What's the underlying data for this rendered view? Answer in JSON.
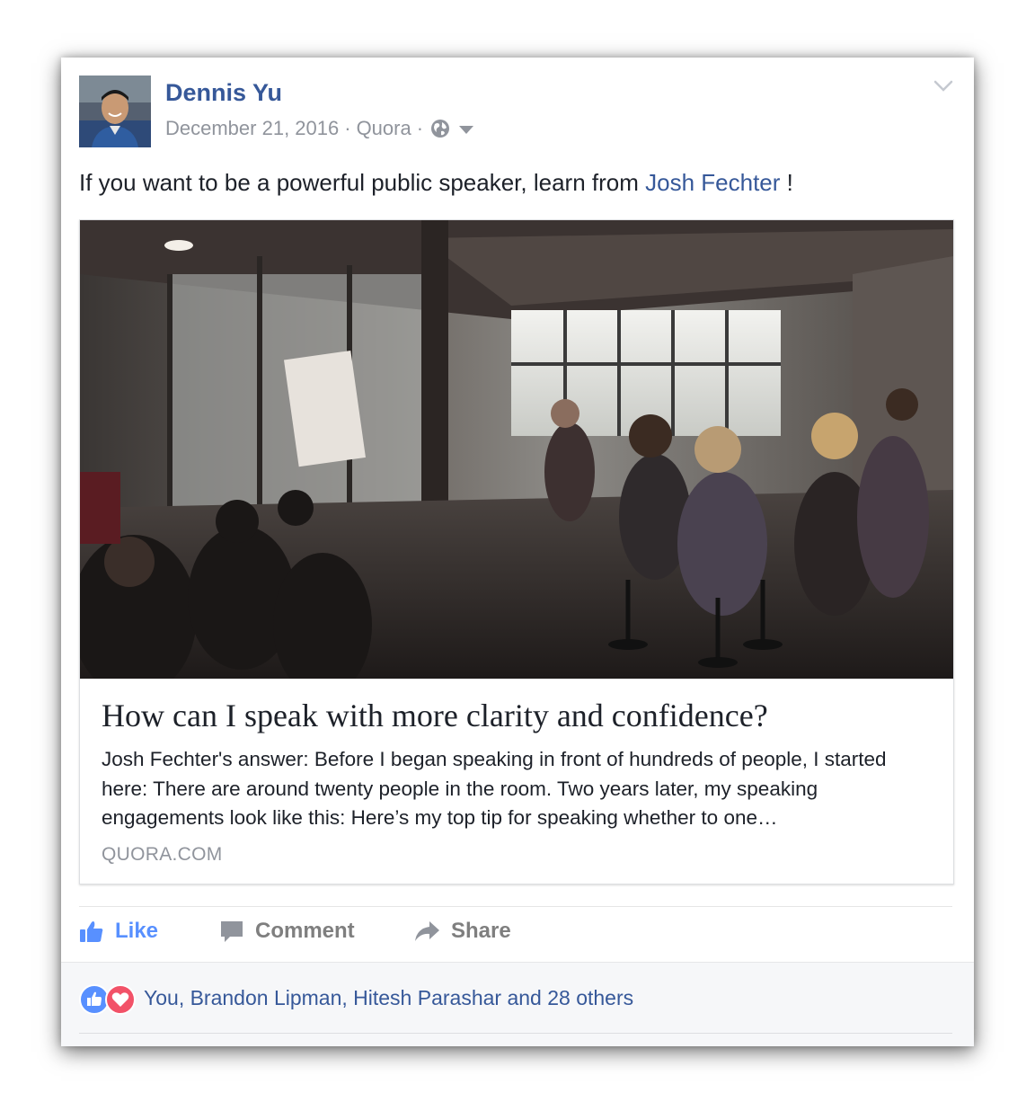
{
  "post": {
    "author": "Dennis Yu",
    "date": "December 21, 2016",
    "source": "Quora",
    "separator": "·",
    "audience_icon": "globe-icon",
    "menu_icon": "chevron-down-icon",
    "text_before": "If you want to be a powerful public speaker, learn from ",
    "mention": "Josh Fechter",
    "text_after": " !"
  },
  "link_preview": {
    "image_icon": "photo-of-speaking-workshop",
    "title": "How can I speak with more clarity and confidence?",
    "description": "Josh Fechter's answer: Before I began speaking in front of hundreds of people, I started here: There are around twenty people in the room. Two years later, my speaking engagements look like this: Here’s my top tip for speaking whether to one…",
    "domain": "QUORA.COM"
  },
  "actions": {
    "like_label": "Like",
    "comment_label": "Comment",
    "share_label": "Share"
  },
  "reactions": {
    "summary": "You, Brandon Lipman, Hitesh Parashar and 28 others",
    "icons": [
      "like-reaction-icon",
      "love-reaction-icon"
    ]
  },
  "colors": {
    "link_blue": "#365899",
    "like_blue": "#5890ff",
    "meta_gray": "#90949c",
    "text": "#1d2129",
    "love_red": "#f25268"
  }
}
